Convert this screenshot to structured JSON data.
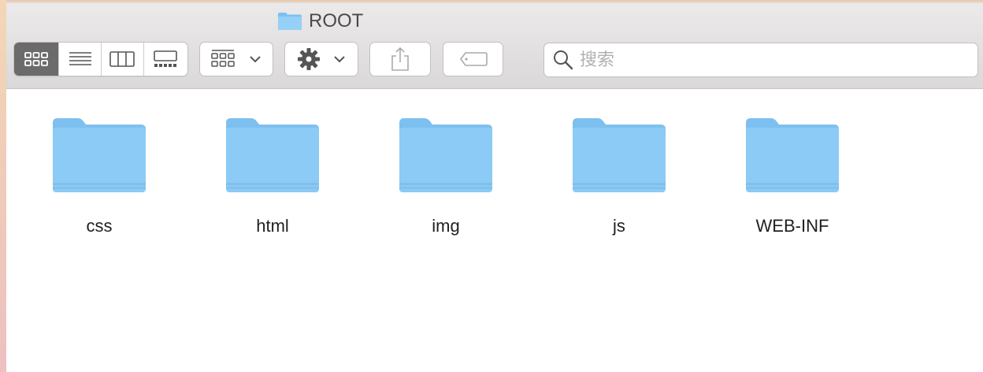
{
  "window": {
    "title": "ROOT",
    "title_icon": "folder-icon"
  },
  "toolbar": {
    "view_modes": [
      {
        "name": "icon-view",
        "icon": "grid-icon",
        "active": true
      },
      {
        "name": "list-view",
        "icon": "list-icon",
        "active": false
      },
      {
        "name": "column-view",
        "icon": "columns-icon",
        "active": false
      },
      {
        "name": "gallery-view",
        "icon": "gallery-icon",
        "active": false
      }
    ],
    "group_icon": "group-grid-icon",
    "action_icon": "gear-icon",
    "share_icon": "share-icon",
    "tag_icon": "tag-icon"
  },
  "search": {
    "placeholder": "搜索",
    "value": ""
  },
  "files": [
    {
      "name": "css",
      "type": "folder"
    },
    {
      "name": "html",
      "type": "folder"
    },
    {
      "name": "img",
      "type": "folder"
    },
    {
      "name": "js",
      "type": "folder"
    },
    {
      "name": "WEB-INF",
      "type": "folder"
    }
  ],
  "colors": {
    "folder": "#8ccbf5",
    "folder_tab": "#7dc0f0",
    "active_segment": "#6b6b6b"
  }
}
